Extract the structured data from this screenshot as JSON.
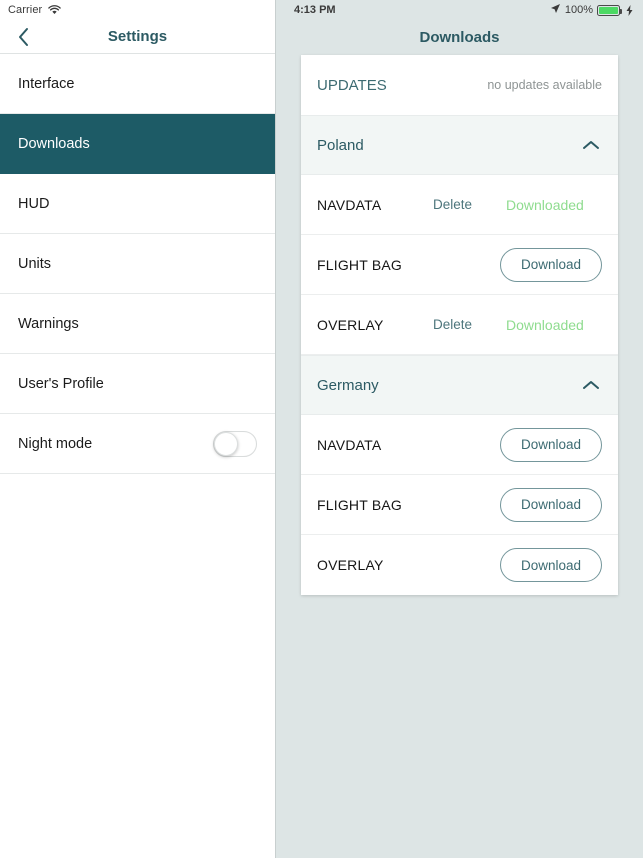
{
  "left": {
    "statusbar": {
      "carrier": "Carrier",
      "wifi_icon": "wifi-icon"
    },
    "header": {
      "title": "Settings",
      "back_icon": "chevron-left-icon"
    },
    "menu": [
      {
        "label": "Interface",
        "selected": false
      },
      {
        "label": "Downloads",
        "selected": true
      },
      {
        "label": "HUD",
        "selected": false
      },
      {
        "label": "Units",
        "selected": false
      },
      {
        "label": "Warnings",
        "selected": false
      },
      {
        "label": "User's Profile",
        "selected": false
      },
      {
        "label": "Night mode",
        "selected": false,
        "toggle": "off"
      }
    ]
  },
  "right": {
    "statusbar": {
      "time": "4:13 PM",
      "location_icon": "location-arrow-icon",
      "battery_percent": "100%",
      "battery_icon": "battery-full-icon",
      "charging_icon": "lightning-bolt-icon"
    },
    "header": {
      "title": "Downloads"
    },
    "updates": {
      "title": "UPDATES",
      "status": "no updates available"
    },
    "sections": [
      {
        "name": "Poland",
        "chevron_icon": "chevron-up-icon",
        "expanded": true,
        "items": [
          {
            "name": "NAVDATA",
            "delete_label": "Delete",
            "state_label": "Downloaded",
            "state": "downloaded"
          },
          {
            "name": "FLIGHT BAG",
            "button_label": "Download",
            "state": "available"
          },
          {
            "name": "OVERLAY",
            "delete_label": "Delete",
            "state_label": "Downloaded",
            "state": "downloaded"
          }
        ]
      },
      {
        "name": "Germany",
        "chevron_icon": "chevron-up-icon",
        "expanded": true,
        "items": [
          {
            "name": "NAVDATA",
            "button_label": "Download",
            "state": "available"
          },
          {
            "name": "FLIGHT BAG",
            "button_label": "Download",
            "state": "available"
          },
          {
            "name": "OVERLAY",
            "button_label": "Download",
            "state": "available"
          }
        ]
      }
    ]
  },
  "colors": {
    "accent_teal": "#2c5a63",
    "selected_bg": "#1d5b66",
    "panel_bg": "#dde5e5",
    "downloaded_green": "#8fdc8f",
    "battery_green": "#4cd964"
  }
}
